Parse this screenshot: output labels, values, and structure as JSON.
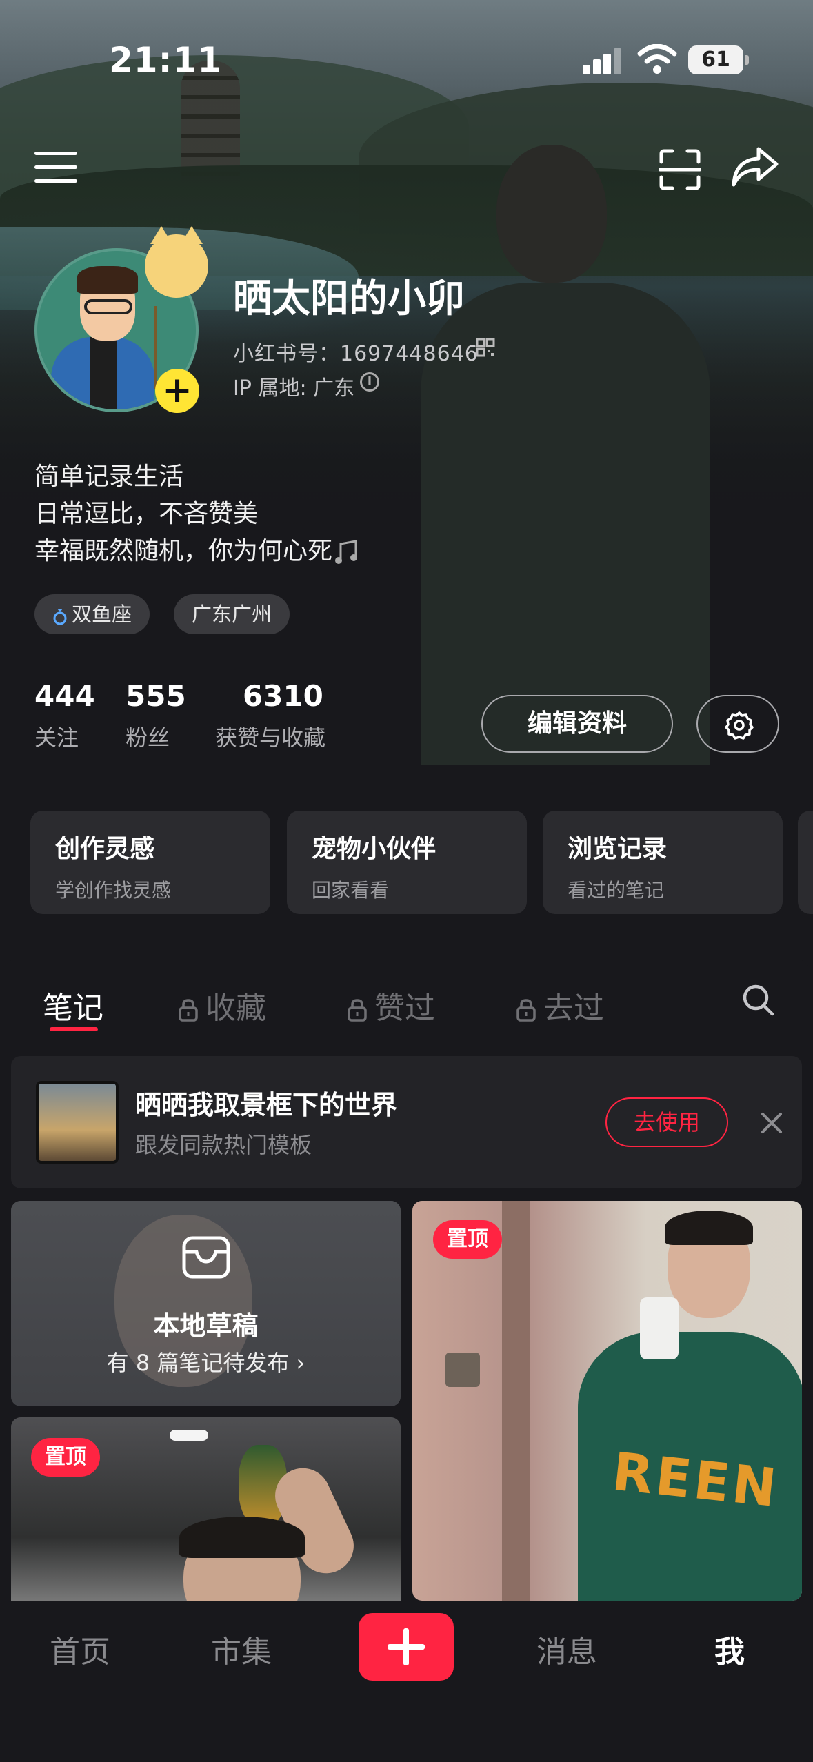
{
  "status_bar": {
    "time": "21:11",
    "battery": "61"
  },
  "profile": {
    "username": "晒太阳的小卯",
    "red_id": "小红书号：1697448646",
    "ip_location": "IP 属地: 广东",
    "bio_lines": [
      "简单记录生活",
      "日常逗比，不吝赞美",
      "幸福既然随机，你为何心死"
    ],
    "tags": [
      "双鱼座",
      "广东广州"
    ]
  },
  "stats": [
    {
      "num": "444",
      "label": "关注"
    },
    {
      "num": "555",
      "label": "粉丝"
    },
    {
      "num": "6310",
      "label": "获赞与收藏"
    }
  ],
  "actions": {
    "edit_profile": "编辑资料"
  },
  "quick_cards": [
    {
      "title": "创作灵感",
      "subtitle": "学创作找灵感"
    },
    {
      "title": "宠物小伙伴",
      "subtitle": "回家看看"
    },
    {
      "title": "浏览记录",
      "subtitle": "看过的笔记"
    }
  ],
  "tabs": [
    "笔记",
    "收藏",
    "赞过",
    "去过"
  ],
  "banner": {
    "title": "晒晒我取景框下的世界",
    "subtitle": "跟发同款热门模板",
    "button": "去使用"
  },
  "draft": {
    "title": "本地草稿",
    "subtitle": "有 8 篇笔记待发布 ›"
  },
  "pinned_label": "置顶",
  "bottom_nav": [
    "首页",
    "市集",
    "消息",
    "我"
  ],
  "colors": {
    "accent": "#ff2442",
    "background": "#18181c",
    "badge_yellow": "#ffe534"
  }
}
